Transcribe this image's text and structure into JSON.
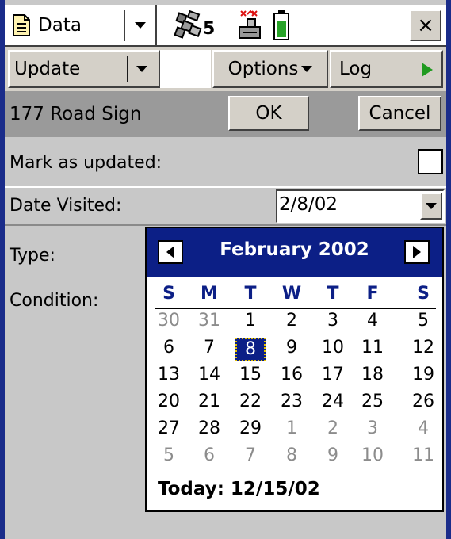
{
  "colors": {
    "window_border": "#1a2c8a",
    "calendar_header": "#0c1f86",
    "selected_day": "#0c1f86",
    "focus_outline": "#e6c200",
    "other_month_day": "#8c8c8c",
    "record_bar": "#9a9a9a",
    "log_play": "#1f9a1f",
    "battery": "#27a327"
  },
  "topbar": {
    "menu_label": "Data",
    "satellite_count": "5",
    "close_symbol": "×"
  },
  "menubar": {
    "update_label": "Update",
    "options_label": "Options",
    "log_label": "Log"
  },
  "record": {
    "title": "177 Road Sign",
    "ok_label": "OK",
    "cancel_label": "Cancel"
  },
  "form": {
    "mark_updated_label": "Mark as updated:",
    "date_visited_label": "Date Visited:",
    "date_visited_value": "2/8/02",
    "type_label": "Type:",
    "condition_label": "Condition:"
  },
  "calendar": {
    "month_title": "February 2002",
    "weekdays": [
      "S",
      "M",
      "T",
      "W",
      "T",
      "F",
      "S"
    ],
    "weeks": [
      [
        {
          "d": "30",
          "o": true
        },
        {
          "d": "31",
          "o": true
        },
        {
          "d": "1"
        },
        {
          "d": "2"
        },
        {
          "d": "3"
        },
        {
          "d": "4"
        },
        {
          "d": "5"
        }
      ],
      [
        {
          "d": "6"
        },
        {
          "d": "7"
        },
        {
          "d": "8",
          "sel": true
        },
        {
          "d": "9"
        },
        {
          "d": "10"
        },
        {
          "d": "11"
        },
        {
          "d": "12"
        }
      ],
      [
        {
          "d": "13"
        },
        {
          "d": "14"
        },
        {
          "d": "15"
        },
        {
          "d": "16"
        },
        {
          "d": "17"
        },
        {
          "d": "18"
        },
        {
          "d": "19"
        }
      ],
      [
        {
          "d": "20"
        },
        {
          "d": "21"
        },
        {
          "d": "22"
        },
        {
          "d": "23"
        },
        {
          "d": "24"
        },
        {
          "d": "25"
        },
        {
          "d": "26"
        }
      ],
      [
        {
          "d": "27"
        },
        {
          "d": "28"
        },
        {
          "d": "29"
        },
        {
          "d": "1",
          "o": true
        },
        {
          "d": "2",
          "o": true
        },
        {
          "d": "3",
          "o": true
        },
        {
          "d": "4",
          "o": true
        }
      ],
      [
        {
          "d": "5",
          "o": true
        },
        {
          "d": "6",
          "o": true
        },
        {
          "d": "7",
          "o": true
        },
        {
          "d": "8",
          "o": true
        },
        {
          "d": "9",
          "o": true
        },
        {
          "d": "10",
          "o": true
        },
        {
          "d": "11",
          "o": true
        }
      ]
    ],
    "today_label": "Today: 12/15/02"
  }
}
